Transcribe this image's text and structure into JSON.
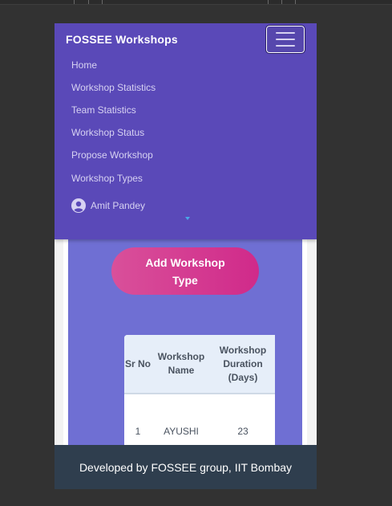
{
  "navbar": {
    "brand": "FOSSEE Workshops",
    "toggler_icon": "hamburger-icon",
    "items": [
      {
        "label": "Home"
      },
      {
        "label": "Workshop Statistics"
      },
      {
        "label": "Team Statistics"
      },
      {
        "label": "Workshop Status"
      },
      {
        "label": "Propose Workshop"
      },
      {
        "label": "Workshop Types"
      }
    ],
    "user": {
      "name": "Amit Pandey",
      "icon": "user-circle-icon"
    }
  },
  "main": {
    "add_button_label": "Add Workshop Type",
    "table": {
      "headers": [
        "Sr No",
        "Workshop Name",
        "Workshop Duration (Days)"
      ],
      "rows": [
        [
          "1",
          "AYUSHI",
          "23"
        ]
      ]
    }
  },
  "footer": {
    "text": "Developed by FOSSEE group, IIT Bombay"
  },
  "colors": {
    "navbar": "#5a49b8",
    "card": "#6f6fd3",
    "button": "#d02a8a",
    "footer": "#2f3e4e"
  }
}
